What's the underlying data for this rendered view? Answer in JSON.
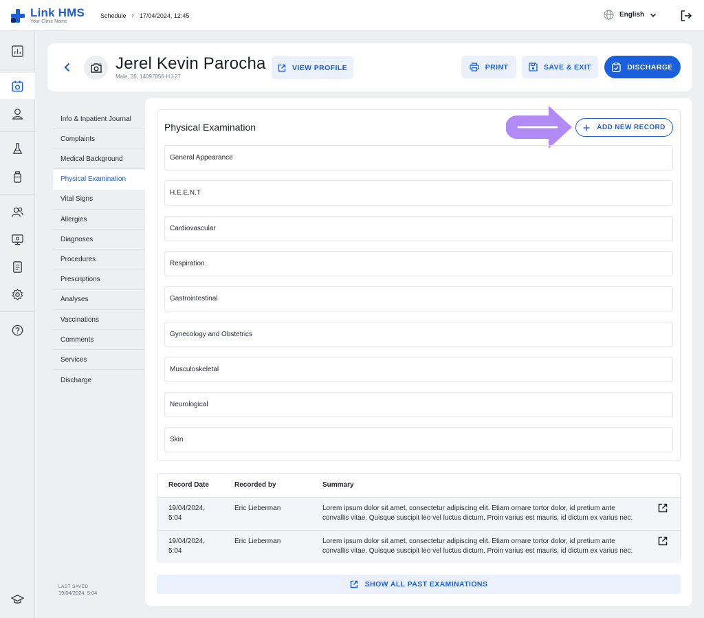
{
  "app": {
    "logo_title": "Link HMS",
    "logo_subtitle": "Your Clinic Name",
    "accent_color": "#1d5fd6"
  },
  "topbar": {
    "breadcrumb_schedule": "Schedule",
    "breadcrumb_separator": "›",
    "breadcrumb_datetime": "17/04/2024, 12:45",
    "language": "English"
  },
  "rail": {
    "icons": [
      "dashboard-icon",
      "calendar-icon",
      "user-icon",
      "lab-flask-icon",
      "medicine-bottle-icon",
      "users-icon",
      "monitor-icon",
      "document-icon",
      "settings-icon",
      "help-icon",
      "graduation-cap-icon"
    ],
    "active": "calendar-icon"
  },
  "patient": {
    "name": "Jerel Kevin Parocha",
    "meta": "Male, 35, 14097856-HJ-27"
  },
  "header": {
    "view_profile": "VIEW PROFILE",
    "print": "PRINT",
    "save_exit": "SAVE & EXIT",
    "discharge": "DISCHARGE"
  },
  "nav": {
    "items": [
      {
        "label": "Info & Inpatient Journal"
      },
      {
        "label": "Complaints"
      },
      {
        "label": "Medical Background"
      },
      {
        "label": "Physical Examination"
      },
      {
        "label": "Vital Signs"
      },
      {
        "label": "Allergies"
      },
      {
        "label": "Diagnoses"
      },
      {
        "label": "Procedures"
      },
      {
        "label": "Prescriptions"
      },
      {
        "label": "Analyses"
      },
      {
        "label": "Vaccinations"
      },
      {
        "label": "Comments"
      },
      {
        "label": "Services"
      },
      {
        "label": "Discharge"
      }
    ],
    "active": "Physical Examination",
    "last_saved_label": "LAST SAVED",
    "last_saved_value": "19/04/2024, 5:04"
  },
  "exam": {
    "title": "Physical Examination",
    "add_button": "ADD NEW RECORD",
    "sections": [
      {
        "label": "General Appearance"
      },
      {
        "label": "H.E.E.N.T"
      },
      {
        "label": "Cardiovascular"
      },
      {
        "label": "Respiration"
      },
      {
        "label": "Gastrointestinal"
      },
      {
        "label": "Gynecology and Obstetrics"
      },
      {
        "label": "Musculoskeletal"
      },
      {
        "label": "Neurological"
      },
      {
        "label": "Skin"
      }
    ]
  },
  "records": {
    "columns": [
      "Record Date",
      "Recorded by",
      "Summary"
    ],
    "rows": [
      {
        "date_line1": "19/04/2024,",
        "date_line2": "5:04",
        "recorded_by": "Eric Lieberman",
        "summary_line1": "Lorem ipsum dolor sit amet, consectetur adipiscing elit. Etiam ornare tortor dolor, id pretium ante",
        "summary_line2": "convallis vitae. Quisque suscipit leo vel luctus dictum. Proin varius est mauris, id dictum ex varius nec."
      },
      {
        "date_line1": "19/04/2024,",
        "date_line2": "5:04",
        "recorded_by": "Eric Lieberman",
        "summary_line1": "Lorem ipsum dolor sit amet, consectetur adipiscing elit. Etiam ornare tortor dolor, id pretium ante",
        "summary_line2": "convallis vitae. Quisque suscipit leo vel luctus dictum. Proin varius est mauris, id dictum ex varius nec."
      }
    ],
    "show_all": "SHOW ALL PAST EXAMINATIONS"
  }
}
